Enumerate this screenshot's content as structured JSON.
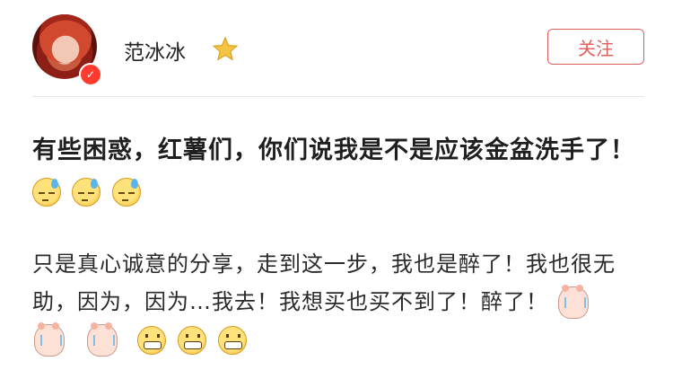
{
  "post": {
    "author": {
      "name": "范冰冰",
      "badge": "star-icon",
      "verified": true
    },
    "follow_label": "关注",
    "title_text": "有些困惑，红薯们，你们说我是不是应该金盆洗手了！",
    "title_emojis": [
      "sweat-emoji",
      "sweat-emoji",
      "sweat-emoji"
    ],
    "body_text": "只是真心诚意的分享，走到这一步，我也是醉了！我也很无助，因为，因为…我去！我想买也买不到了！醉了！",
    "body_emojis": [
      "crying-pig-emoji",
      "crying-pig-emoji",
      "crying-pig-emoji",
      "grin-emoji",
      "grin-emoji",
      "grin-emoji"
    ]
  },
  "colors": {
    "accent": "#e0605c",
    "verified": "#ff3b30",
    "star": "#f6c344"
  }
}
